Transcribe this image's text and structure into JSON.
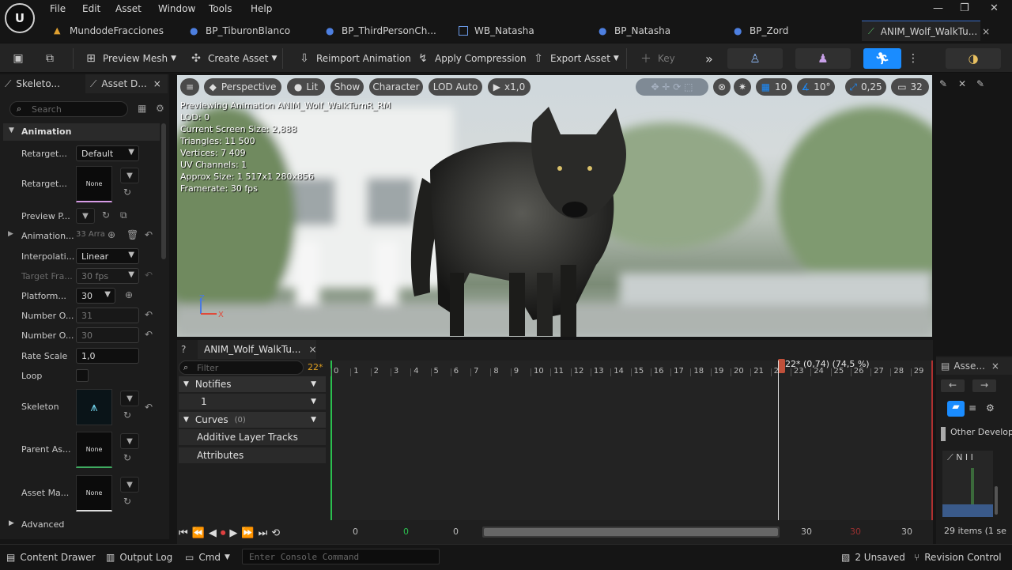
{
  "menu": {
    "items": [
      "File",
      "Edit",
      "Asset",
      "Window",
      "Tools",
      "Help"
    ]
  },
  "tabs": [
    {
      "label": "MundodeFracciones"
    },
    {
      "label": "BP_TiburonBlanco"
    },
    {
      "label": "BP_ThirdPersonCh..."
    },
    {
      "label": "WB_Natasha"
    },
    {
      "label": "BP_Natasha"
    },
    {
      "label": "BP_Zord"
    },
    {
      "label": "ANIM_Wolf_WalkTu...",
      "close": "×"
    }
  ],
  "toolbar": {
    "preview_mesh": "Preview Mesh",
    "create_asset": "Create Asset",
    "reimport": "Reimport Animation",
    "apply_compression": "Apply Compression",
    "export_asset": "Export Asset",
    "key": "Key"
  },
  "left_tabs": {
    "skeleton": "Skeleto...",
    "asset_details": "Asset D...",
    "close": "×"
  },
  "search": {
    "placeholder": "Search"
  },
  "section": {
    "animation": "Animation",
    "advanced": "Advanced"
  },
  "props": {
    "retarget1": {
      "label": "Retarget...",
      "value": "Default"
    },
    "retarget2": {
      "label": "Retarget...",
      "thumb": "None"
    },
    "preview_pose": {
      "label": "Preview P..."
    },
    "animation_arr": {
      "label": "Animation...",
      "value": "33 Arra"
    },
    "interpolation": {
      "label": "Interpolati...",
      "value": "Linear"
    },
    "target_frame": {
      "label": "Target Fra...",
      "value": "30 fps"
    },
    "platform": {
      "label": "Platform...",
      "value": "30"
    },
    "number1": {
      "label": "Number O...",
      "value": "31"
    },
    "number2": {
      "label": "Number O...",
      "value": "30"
    },
    "rate_scale": {
      "label": "Rate Scale",
      "value": "1,0"
    },
    "loop": {
      "label": "Loop"
    },
    "skeleton": {
      "label": "Skeleton"
    },
    "parent_asset": {
      "label": "Parent As...",
      "thumb": "None"
    },
    "asset_mapping": {
      "label": "Asset Ma...",
      "thumb": "None"
    }
  },
  "viewport": {
    "perspective": "Perspective",
    "lit": "Lit",
    "show": "Show",
    "character": "Character",
    "lod": "LOD Auto",
    "speed": "x1,0",
    "grid_snap": "10",
    "rot_snap": "10°",
    "scale_snap": "0,25",
    "cam_speed": "32",
    "info": [
      "Previewing Animation ANIM_Wolf_WalkTurnR_RM",
      "LOD: 0",
      "Current Screen Size: 2,888",
      "Triangles: 11 500",
      "Vertices: 7 409",
      "UV Channels: 1",
      "Approx Size: 1 517x1 280x856",
      "Framerate: 30 fps"
    ]
  },
  "sequencer": {
    "tab": "ANIM_Wolf_WalkTu...",
    "close": "×",
    "filter_placeholder": "Filter",
    "frame_badge": "22*",
    "notifies": "Notifies",
    "notify_track": "1",
    "curves": "Curves",
    "curves_count": "(0)",
    "additive": "Additive Layer Tracks",
    "attributes": "Attributes",
    "playhead_label": "22* (0,74) (74,5 %)",
    "ticks": [
      "0",
      "1",
      "2",
      "3",
      "4",
      "5",
      "6",
      "7",
      "8",
      "9",
      "10",
      "11",
      "12",
      "13",
      "14",
      "15",
      "16",
      "17",
      "18",
      "19",
      "20",
      "21",
      "22",
      "23",
      "24",
      "25",
      "26",
      "27",
      "28",
      "29"
    ],
    "range_start": "0",
    "range_start_green": "0",
    "range_start2": "0",
    "range_end": "30",
    "range_end_red": "30",
    "range_end2": "30"
  },
  "asset_browser": {
    "tab": "Asse...",
    "close": "×",
    "folder": "Other Develop",
    "items": "29 items (1 se"
  },
  "status": {
    "content_drawer": "Content Drawer",
    "output_log": "Output Log",
    "cmd": "Cmd",
    "console_placeholder": "Enter Console Command",
    "unsaved": "2 Unsaved",
    "revision": "Revision Control"
  },
  "colors": {
    "accent_blue": "#1a8cff",
    "playhead": "#d06a4a",
    "viewport_bg": "#cfd8dc"
  }
}
